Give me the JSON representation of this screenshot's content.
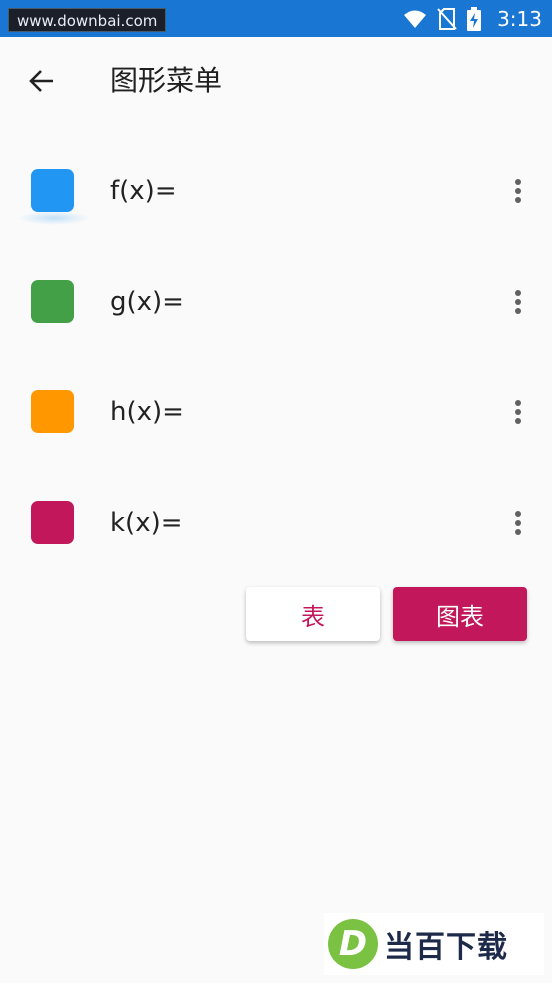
{
  "status_bar": {
    "watermark": "www.downbai.com",
    "time": "3:13",
    "icons": [
      "wifi-icon",
      "no-sim-icon",
      "battery-charging-icon"
    ]
  },
  "app_bar": {
    "back_icon": "arrow-left-icon",
    "title": "图形菜单"
  },
  "functions": [
    {
      "label": "f(x)=",
      "color": "#2196f3"
    },
    {
      "label": "g(x)=",
      "color": "#43a047"
    },
    {
      "label": "h(x)=",
      "color": "#ff9800"
    },
    {
      "label": "k(x)=",
      "color": "#c2185b"
    }
  ],
  "buttons": {
    "table_label": "表",
    "graph_label": "图表"
  },
  "colors": {
    "status_bar": "#1976d2",
    "accent": "#c2185b",
    "background": "#fafafa"
  },
  "watermark_bottom": {
    "logo_letter": "D",
    "text": "当百下载"
  }
}
